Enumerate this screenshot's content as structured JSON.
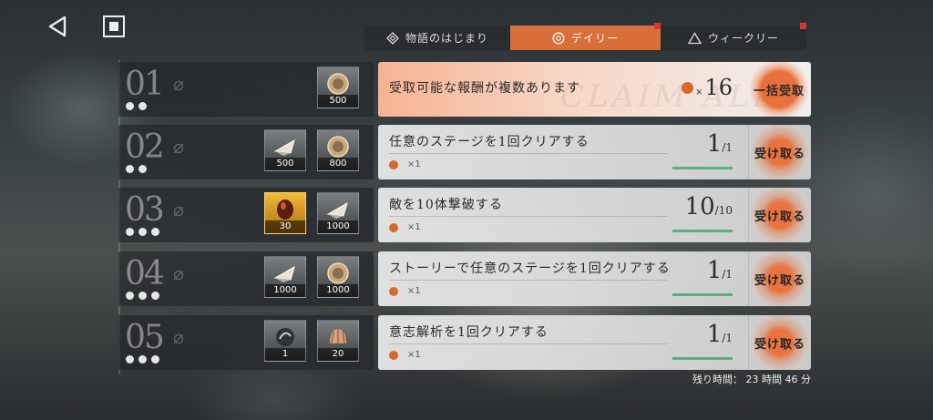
{
  "nav": {
    "back_icon": "back-triangle-icon",
    "stop_icon": "stop-square-icon"
  },
  "tabs": [
    {
      "label": "物語のはじまり",
      "icon": "diamond-icon",
      "active": false,
      "badge": false
    },
    {
      "label": "デイリー",
      "icon": "circle-icon",
      "active": true,
      "badge": true
    },
    {
      "label": "ウィークリー",
      "icon": "triangle-icon",
      "active": false,
      "badge": true
    }
  ],
  "claim_all": {
    "number": "01",
    "reward_count": "500",
    "title": "受取可能な報酬が複数あります",
    "multiplier_prefix": "×",
    "multiplier": "16",
    "button": "一括受取",
    "watermark": "CLAIM ALL"
  },
  "missions": [
    {
      "number": "02",
      "dots": 2,
      "rewards": [
        {
          "count": "500",
          "kind": "crystal",
          "gold": false
        },
        {
          "count": "800",
          "kind": "coin",
          "gold": false
        }
      ],
      "title": "任意のステージを1回クリアする",
      "reward_label": "×1",
      "progress_num": "1",
      "progress_den": "1",
      "button": "受け取る"
    },
    {
      "number": "03",
      "dots": 3,
      "rewards": [
        {
          "count": "30",
          "kind": "gem",
          "gold": true
        },
        {
          "count": "1000",
          "kind": "crystal",
          "gold": false
        }
      ],
      "title": "敵を10体撃破する",
      "reward_label": "×1",
      "progress_num": "10",
      "progress_den": "10",
      "button": "受け取る"
    },
    {
      "number": "04",
      "dots": 3,
      "rewards": [
        {
          "count": "1000",
          "kind": "crystal",
          "gold": false
        },
        {
          "count": "1000",
          "kind": "coin",
          "gold": false
        }
      ],
      "title": "ストーリーで任意のステージを1回クリアする",
      "reward_label": "×1",
      "progress_num": "1",
      "progress_den": "1",
      "button": "受け取る"
    },
    {
      "number": "05",
      "dots": 3,
      "rewards": [
        {
          "count": "1",
          "kind": "orb",
          "gold": false
        },
        {
          "count": "20",
          "kind": "shell",
          "gold": false
        }
      ],
      "title": "意志解析を1回クリアする",
      "reward_label": "×1",
      "progress_num": "1",
      "progress_den": "1",
      "button": "受け取る"
    }
  ],
  "remaining_time": "残り時間： 23 時間 46 分",
  "colors": {
    "accent": "#d86f3a",
    "badge": "#d23a2a",
    "progress": "#59b07b"
  }
}
